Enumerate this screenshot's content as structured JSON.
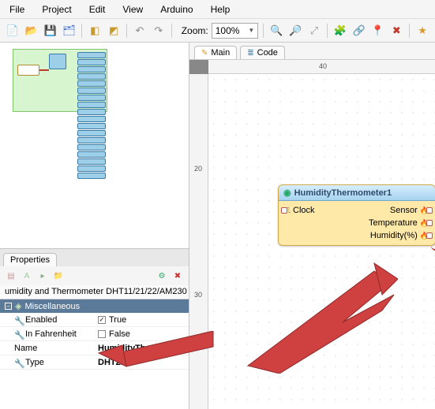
{
  "menu": {
    "file": "File",
    "project": "Project",
    "edit": "Edit",
    "view": "View",
    "arduino": "Arduino",
    "help": "Help"
  },
  "toolbar": {
    "zoom_label": "Zoom:",
    "zoom_value": "100%"
  },
  "tabs": {
    "main": "Main",
    "code": "Code"
  },
  "ruler": {
    "h40": "40",
    "v20": "20",
    "v30": "30"
  },
  "node": {
    "title": "HumidityThermometer1",
    "clock": "Clock",
    "sensor": "Sensor",
    "temperature": "Temperature",
    "humidity": "Humidity(%)"
  },
  "properties": {
    "panel_title": "Properties",
    "header": "umidity and Thermometer DHT11/21/22/AM230",
    "group": "Miscellaneous",
    "rows": {
      "enabled": {
        "name": "Enabled",
        "value": "True",
        "checked": true
      },
      "fahrenheit": {
        "name": "In Fahrenheit",
        "value": "False",
        "checked": false
      },
      "name": {
        "name": "Name",
        "value": "HumidityThermo..."
      },
      "type": {
        "name": "Type",
        "value": "DHT21"
      }
    }
  }
}
